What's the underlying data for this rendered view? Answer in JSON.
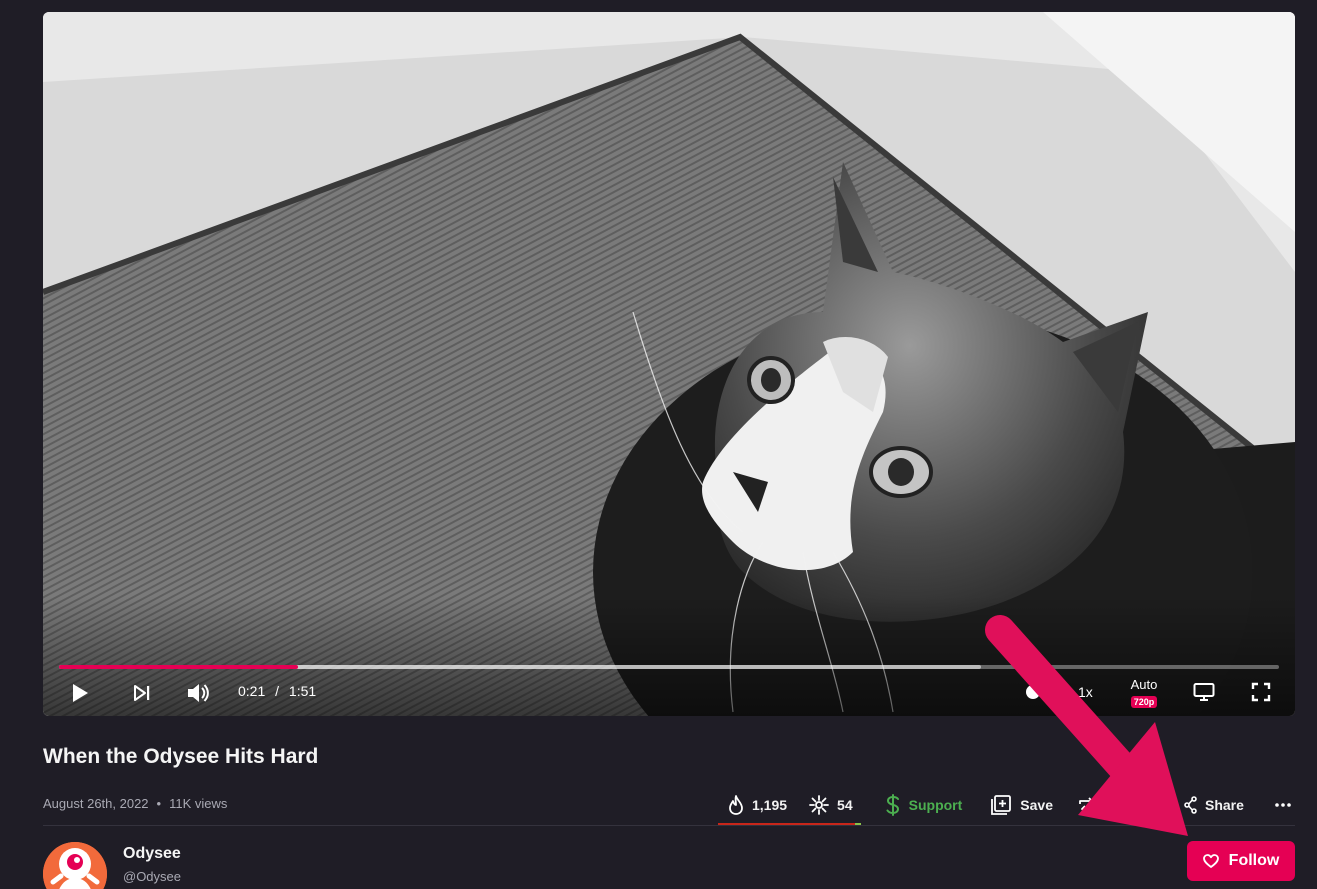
{
  "player": {
    "time_current": "0:21",
    "time_separator": "/",
    "time_total": "1:51",
    "progress_played": 0.196,
    "progress_buffered": 0.756,
    "speed_label": "1x",
    "quality_label": "Auto",
    "quality_badge": "720p",
    "icons": [
      "play-icon",
      "skip-next-icon",
      "volume-icon",
      "autoplay-toggle",
      "theater-mode-icon",
      "fullscreen-icon"
    ]
  },
  "video": {
    "title": "When the Odysee Hits Hard",
    "date": "August 26th, 2022",
    "meta_dot": "•",
    "views": "11K views"
  },
  "actions": {
    "fire_count": "1,195",
    "slime_count": "54",
    "support_label": "Support",
    "save_label": "Save",
    "share_label": "Share"
  },
  "channel": {
    "name": "Odysee",
    "handle": "@Odysee",
    "follow_label": "Follow"
  },
  "colors": {
    "accent": "#e50054",
    "support": "#4caf50",
    "fire_bar": "#c8261a",
    "background": "#1f1d26"
  }
}
